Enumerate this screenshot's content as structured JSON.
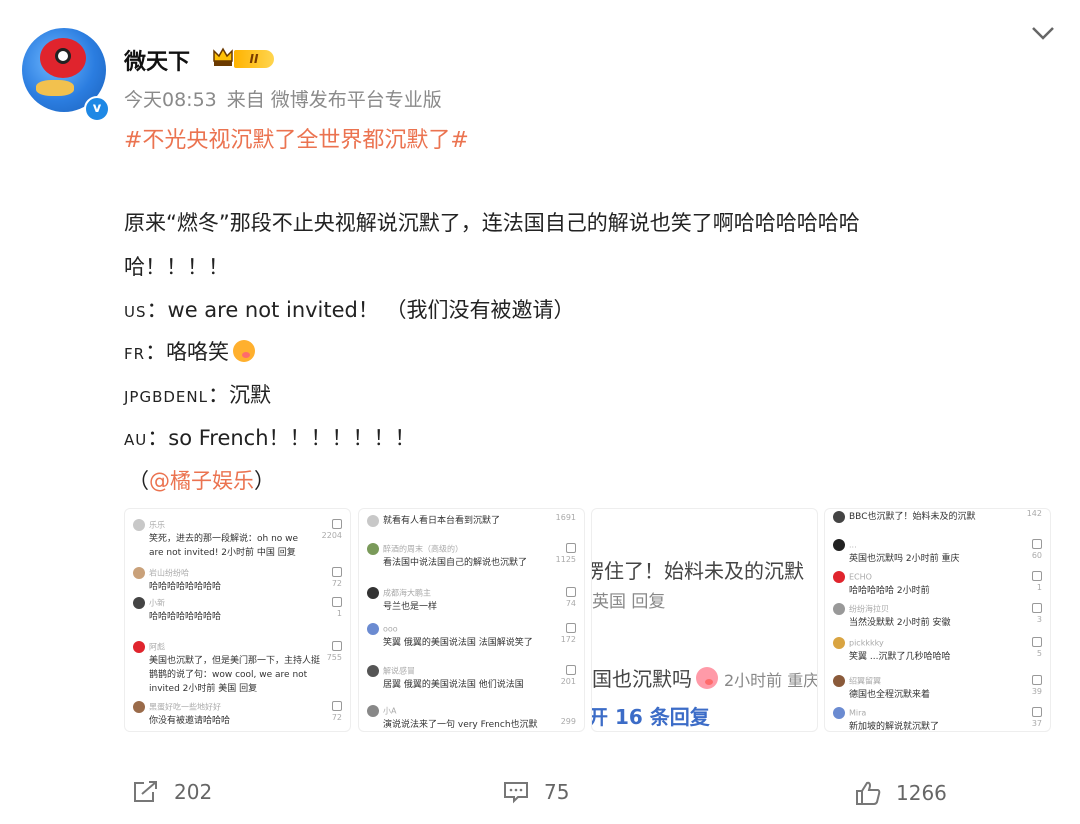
{
  "post": {
    "username": "微天下",
    "level_badge": "II",
    "time": "今天08:53",
    "source": "来自 微博发布平台专业版",
    "hashtag": "#不光央视沉默了全世界都沉默了#",
    "text_line1": "原来“燃冬”那段不止央视解说沉默了，连法国自己的解说也笑了啊哈哈哈哈哈哈",
    "text_line2": "哈！！！！",
    "lines": [
      {
        "speaker": "US",
        "sep": "：",
        "text": "we are not invited！ （我们没有被邀请）"
      },
      {
        "speaker": "FR",
        "sep": "：",
        "text": "咯咯笑"
      },
      {
        "speaker": "JPGBDENL",
        "sep": "：",
        "text": "沉默"
      },
      {
        "speaker": "AU",
        "sep": "：",
        "text": "so French！！！！！！！"
      }
    ],
    "mention_open": "（",
    "mention": "@橘子娱乐",
    "mention_close": "）"
  },
  "thumb1": [
    {
      "name": "乐乐",
      "text": "笑死，进去的那一段解说：oh no we",
      "count": "2204"
    },
    {
      "name": "",
      "text": "are not invited! 2小时前 中国 回复",
      "count": ""
    },
    {
      "name": "岩山纷纷哈",
      "text": "哈哈哈哈哈哈哈哈",
      "count": "72"
    },
    {
      "name": "小新",
      "text": "哈哈哈哈哈哈哈哈",
      "count": "1"
    },
    {
      "name": "阿彪",
      "text": "美国也沉默了，但是美门那一下，主持人挺",
      "count": "755"
    },
    {
      "name": "",
      "text": "鹊鹊的说了句：wow cool, we are not",
      "count": ""
    },
    {
      "name": "",
      "text": "invited 2小时前 美国 回复",
      "count": ""
    },
    {
      "name": "黑蛋好吃一些地好好",
      "text": "你没有被邀请哈哈哈",
      "count": "72"
    }
  ],
  "thumb2": [
    {
      "name": "",
      "text": "就看有人看日本台看到沉默了",
      "count": "1691"
    },
    {
      "name": "醉酒的周末（高级的）",
      "text": "看法国中说法国自己的解说也沉默了",
      "count": "1125"
    },
    {
      "name": "成都海大鹏主",
      "text": "号兰也是一样",
      "count": "74"
    },
    {
      "name": "ooo",
      "text": "笑翼 俄翼的美国说法国 法国解说笑了",
      "count": "172"
    },
    {
      "name": "解说感冒",
      "text": "居翼 俄翼的美国说法国 他们说法国",
      "count": "201"
    },
    {
      "name": "小A",
      "text": "演说说法来了一句 very French也沉默",
      "count": "299"
    }
  ],
  "thumb3": {
    "l1": "愣住了！始料未及的沉默",
    "l2": "英国 回复",
    "l3": "国也沉默吗",
    "l3b": "2小时前 重庆",
    "l4": "开 16 条回复"
  },
  "thumb4": [
    {
      "name": "",
      "text": "BBC也沉默了！始料未及的沉默",
      "count": "142"
    },
    {
      "name": "...",
      "text": "英国也沉默吗 2小时前 重庆",
      "count": "60"
    },
    {
      "name": "ECHO",
      "text": "哈哈哈哈哈 2小时前",
      "count": "1"
    },
    {
      "name": "纷纷海拉贝",
      "text": "当然没默默 2小时前 安徽",
      "count": "3"
    },
    {
      "name": "pickkkky",
      "text": "笑翼 ...沉默了几秒哈哈哈",
      "count": "5"
    },
    {
      "name": "绍翼留翼",
      "text": "德国也全程沉默来着",
      "count": "39"
    },
    {
      "name": "Mira",
      "text": "新加坡的解说就沉默了",
      "count": "37"
    }
  ],
  "actions": {
    "repost": "202",
    "comment": "75",
    "like": "1266"
  }
}
